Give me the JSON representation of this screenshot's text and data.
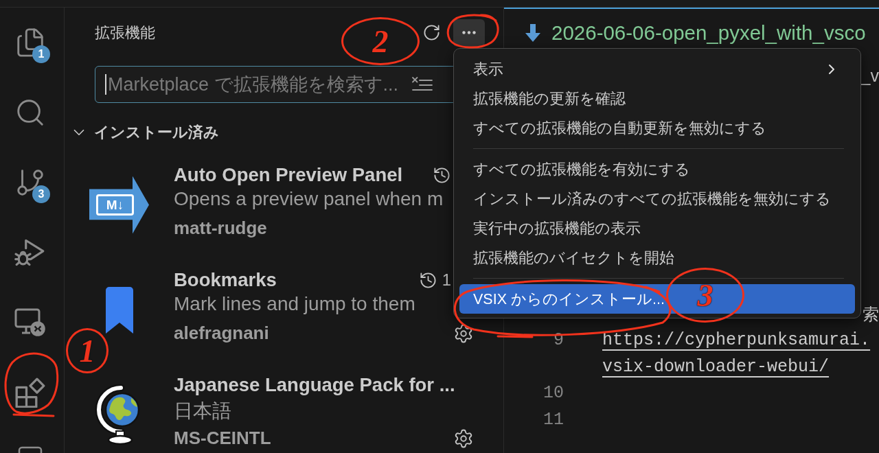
{
  "activity_bar": {
    "explorer_badge": "1",
    "source_control_badge": "3"
  },
  "sidebar": {
    "title": "拡張機能",
    "more_button": {
      "active": true
    },
    "search": {
      "placeholder": "Marketplace で拡張機能を検索す...",
      "focused": true
    },
    "section": {
      "title": "インストール済み",
      "expanded": true
    },
    "extensions": [
      {
        "title": "Auto Open Preview Panel",
        "logo_text": "M↓",
        "description": "Opens a preview panel when m",
        "publisher": "matt-rudge",
        "history": true,
        "manage": false
      },
      {
        "title": "Bookmarks",
        "description": "Mark lines and jump to them",
        "publisher": "alefragnani",
        "history": true,
        "activation_time": "1",
        "manage": true
      },
      {
        "title": "Japanese Language Pack for ...",
        "description": "日本語",
        "publisher": "MS-CEINTL",
        "history": false,
        "manage": true
      }
    ]
  },
  "menu": {
    "groups": [
      {
        "items": [
          {
            "label": "表示",
            "submenu": true,
            "selected": false
          },
          {
            "label": "拡張機能の更新を確認",
            "submenu": false,
            "selected": false
          },
          {
            "label": "すべての拡張機能の自動更新を無効にする",
            "submenu": false,
            "selected": false
          }
        ]
      },
      {
        "items": [
          {
            "label": "すべての拡張機能を有効にする",
            "submenu": false,
            "selected": false
          },
          {
            "label": "インストール済みのすべての拡張機能を無効にする",
            "submenu": false,
            "selected": false
          },
          {
            "label": "実行中の拡張機能の表示",
            "submenu": false,
            "selected": false
          },
          {
            "label": "拡張機能のバイセクトを開始",
            "submenu": false,
            "selected": false
          }
        ]
      },
      {
        "items": [
          {
            "label": "VSIX からのインストール...",
            "submenu": false,
            "selected": true
          }
        ]
      }
    ]
  },
  "editor": {
    "tab": {
      "title": "2026-06-06-open_pyxel_with_vsco"
    },
    "breadcrumb_fragment": "_v",
    "lines": [
      {
        "kind": "fragment",
        "text": "索"
      },
      {
        "kind": "link",
        "number": "9",
        "rows": [
          "https://cypherpunksamurai.",
          "vsix-downloader-webui/"
        ]
      },
      {
        "kind": "empty",
        "number": "10"
      },
      {
        "kind": "empty",
        "number": "11"
      }
    ]
  },
  "annotations": [
    {
      "label": "1"
    },
    {
      "label": "2"
    },
    {
      "label": "3"
    }
  ]
}
